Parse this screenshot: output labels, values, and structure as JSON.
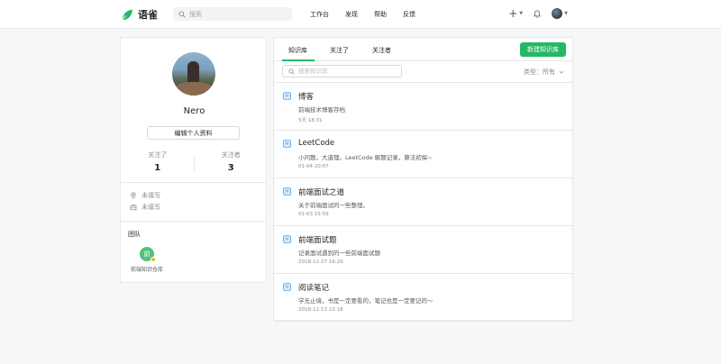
{
  "header": {
    "logo_text": "语雀",
    "search_placeholder": "搜索",
    "nav": [
      "工作台",
      "发现",
      "帮助",
      "反馈"
    ],
    "plus_label": "+"
  },
  "profile": {
    "name": "Nero",
    "edit_label": "编辑个人资料",
    "following_label": "关注了",
    "following_count": "1",
    "followers_label": "关注者",
    "followers_count": "3",
    "location": "未填写",
    "workplace": "未填写",
    "team_title": "团队",
    "team_avatar_char": "前",
    "team_name": "前端知识仓库"
  },
  "main": {
    "tabs": [
      "知识库",
      "关注了",
      "关注者"
    ],
    "new_button": "新建知识库",
    "search_placeholder": "搜索知识库",
    "type_filter": "类型：所有",
    "accent_color": "#25b864",
    "items": [
      {
        "title": "博客",
        "desc": "前端技术博客存档",
        "time": "5天 18:31"
      },
      {
        "title": "LeetCode",
        "desc": "小问题，大道理。LeetCode 解题记录，算法初探~",
        "time": "01-04 20:07"
      },
      {
        "title": "前端面试之道",
        "desc": "关于前端面试的一些整理。",
        "time": "01-03 15:59"
      },
      {
        "title": "前端面试题",
        "desc": "记录面试遇到的一些前端面试题",
        "time": "2018-12-27 16:29"
      },
      {
        "title": "阅读笔记",
        "desc": "学无止境，书是一定要看的，笔记也是一定要记的～",
        "time": "2018-11-13 22:18"
      }
    ]
  }
}
